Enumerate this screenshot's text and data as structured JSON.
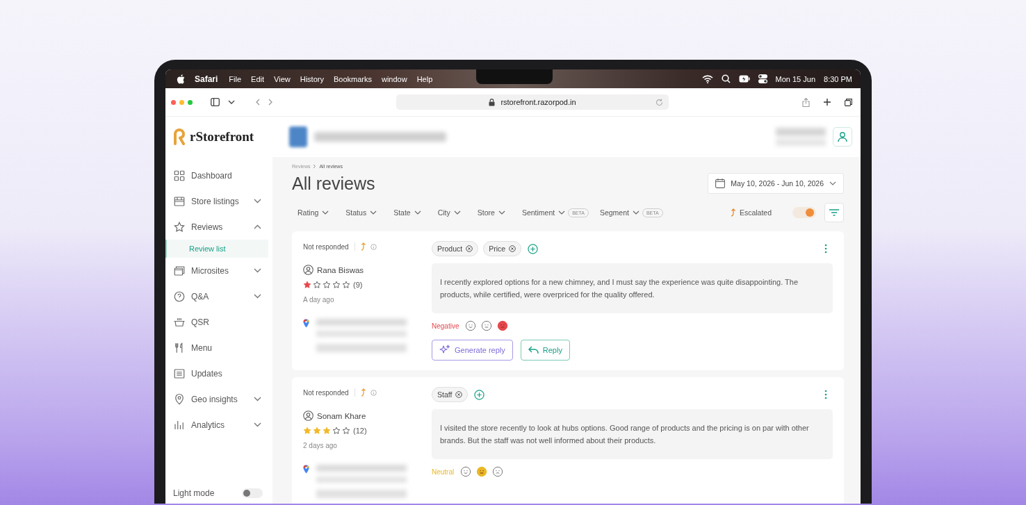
{
  "menu_bar": {
    "app": "Safari",
    "menus": [
      "File",
      "Edit",
      "View",
      "History",
      "Bookmarks",
      "window",
      "Help"
    ],
    "date": "Mon 15 Jun",
    "time": "8:30 PM"
  },
  "browser": {
    "url": "rstorefront.razorpod.in"
  },
  "brand": {
    "name": "rStorefront"
  },
  "sidebar": {
    "items": [
      {
        "label": "Dashboard",
        "kind": "link",
        "selected": false
      },
      {
        "label": "Store listings",
        "kind": "group",
        "expanded": false,
        "selected": false
      },
      {
        "label": "Reviews",
        "kind": "group",
        "expanded": true,
        "selected": false,
        "children": [
          {
            "label": "Review list",
            "selected": true
          }
        ]
      },
      {
        "label": "Microsites",
        "kind": "group",
        "expanded": false,
        "selected": false
      },
      {
        "label": "Q&A",
        "kind": "group",
        "expanded": false,
        "selected": false
      },
      {
        "label": "QSR",
        "kind": "link",
        "selected": false
      },
      {
        "label": "Menu",
        "kind": "link",
        "selected": false
      },
      {
        "label": "Updates",
        "kind": "link",
        "selected": false
      },
      {
        "label": "Geo insights",
        "kind": "group",
        "expanded": false,
        "selected": false
      },
      {
        "label": "Analytics",
        "kind": "group",
        "expanded": false,
        "selected": false
      }
    ],
    "light_mode": {
      "label": "Light mode",
      "on": false
    }
  },
  "breadcrumb": [
    "Reviews",
    "All reviews"
  ],
  "title": "All reviews",
  "date_range": "May 10, 2026 - Jun 10, 2026",
  "filters": [
    {
      "label": "Rating"
    },
    {
      "label": "Status"
    },
    {
      "label": "State"
    },
    {
      "label": "City"
    },
    {
      "label": "Store"
    },
    {
      "label": "Sentiment",
      "badge": "BETA"
    },
    {
      "label": "Segment",
      "badge": "BETA"
    }
  ],
  "escalated": {
    "label": "Escalated",
    "on": true
  },
  "reviews": [
    {
      "status": "Not responded",
      "reviewer": "Rana Biswas",
      "stars": 1,
      "count": "(9)",
      "time": "A day ago",
      "tags": [
        "Product",
        "Price"
      ],
      "text": "I recently explored options for a new chimney, and I must say the experience was quite disappointing. The products, while certified, were overpriced for the quality offered.",
      "sentiment": {
        "kind": "negative",
        "label": "Negative",
        "faces": [
          {
            "selected": false
          },
          {
            "selected": false
          },
          {
            "selected": true
          }
        ]
      },
      "actions": [
        "Generate reply",
        "Reply"
      ]
    },
    {
      "status": "Not responded",
      "reviewer": "Sonam Khare",
      "stars": 3,
      "count": "(12)",
      "time": "2 days ago",
      "tags": [
        "Staff"
      ],
      "text": "I visited the store recently to look at hubs options. Good range of products and the pricing is on par with other brands. But the staff was not well informed about their products.",
      "sentiment": {
        "kind": "neutral",
        "label": "Neutral",
        "faces": [
          {
            "selected": false
          },
          {
            "selected": true
          },
          {
            "selected": false
          }
        ]
      }
    }
  ]
}
